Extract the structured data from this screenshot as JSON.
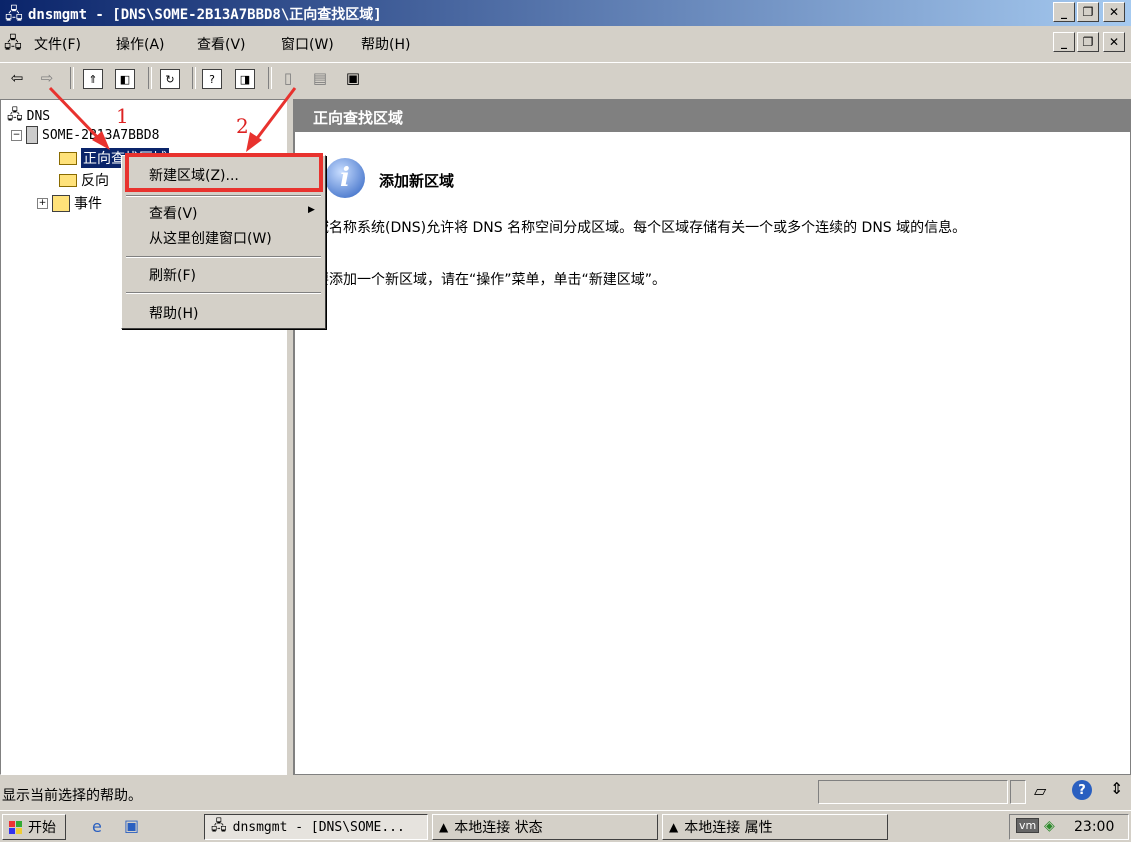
{
  "window": {
    "title": "dnsmgmt - [DNS\\SOME-2B13A7BBD8\\正向查找区域]",
    "minimize": "_",
    "restore": "❐",
    "close": "✕"
  },
  "menubar": {
    "items": [
      "文件(F)",
      "操作(A)",
      "查看(V)",
      "窗口(W)",
      "帮助(H)"
    ]
  },
  "tree": {
    "root": "DNS",
    "server": "SOME-2B13A7BBD8",
    "forward_zone": "正向查找区域",
    "reverse_zone": "反向",
    "events": "事件"
  },
  "context_menu": {
    "new_zone": "新建区域(Z)...",
    "view": "查看(V)",
    "new_window": "从这里创建窗口(W)",
    "refresh": "刷新(F)",
    "help": "帮助(H)",
    "submenu_arrow": "▶"
  },
  "annotations": {
    "step1": "1",
    "step2": "2"
  },
  "right_pane": {
    "header": "正向查找区域",
    "add_title": "添加新区域",
    "desc1": "域名称系统(DNS)允许将 DNS 名称空间分成区域。每个区域存储有关一个或多个连续的 DNS 域的信息。",
    "desc2": "要添加一个新区域，请在“操作”菜单，单击“新建区域”。"
  },
  "statusbar": {
    "text": "显示当前选择的帮助。"
  },
  "taskbar": {
    "start": "开始",
    "tasks": [
      "dnsmgmt - [DNS\\SOME...",
      "本地连接 状态",
      "本地连接 属性"
    ],
    "clock": "23:00"
  },
  "colors": {
    "title_gradient_start": "#0a246a",
    "highlight_red": "#e8322e",
    "selection_blue": "#0a246a"
  }
}
